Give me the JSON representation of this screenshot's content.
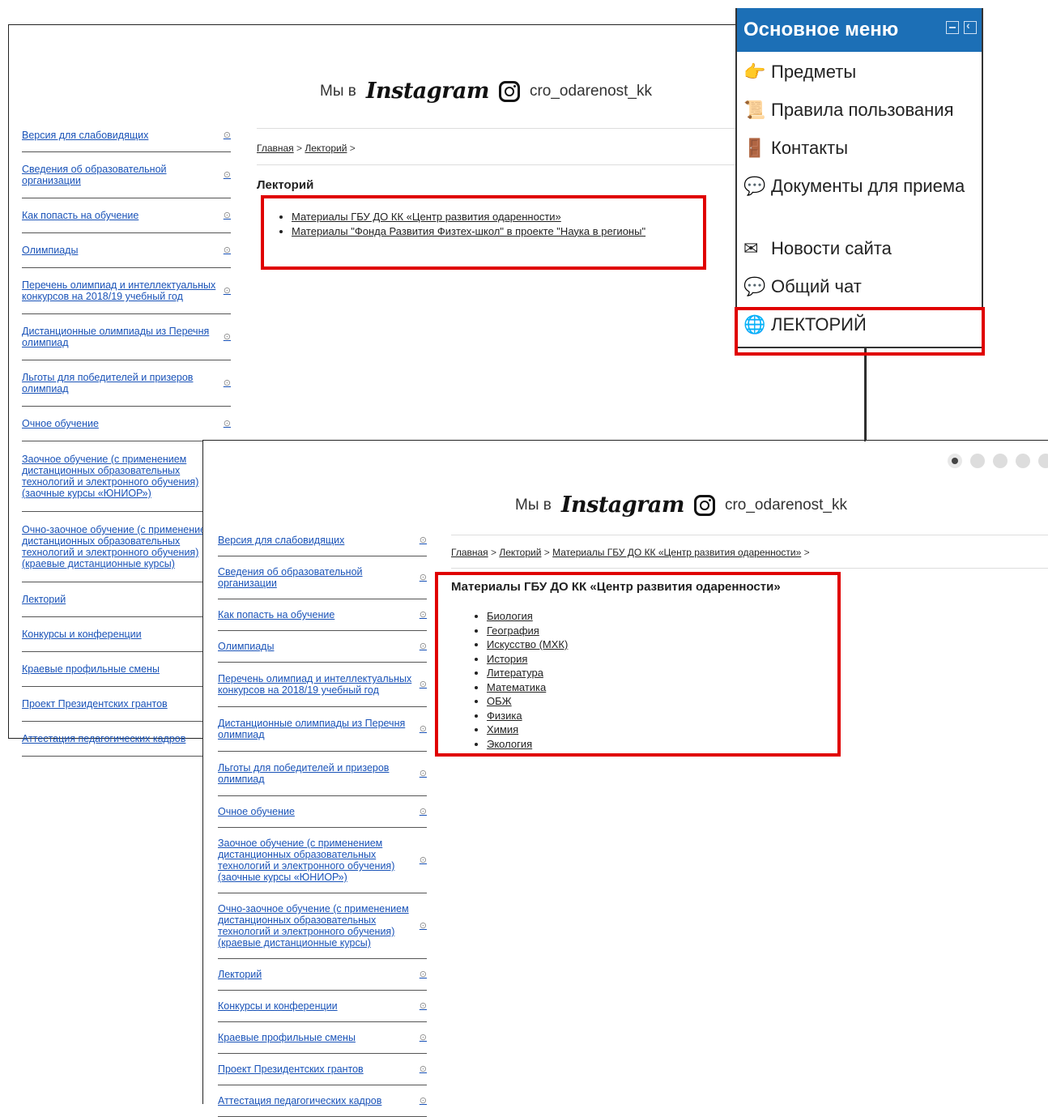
{
  "screen1": {
    "instagram": {
      "prefix": "Мы в",
      "logo_text": "Instagram",
      "handle": "cro_odarenost_kk"
    },
    "breadcrumb": {
      "home": "Главная",
      "sep1": " > ",
      "section": "Лекторий",
      "tail": " >"
    },
    "page_title": "Лекторий",
    "materials": [
      "Материалы ГБУ ДО КК «Центр развития одаренности»",
      "Материалы \"Фонда Развития Физтех-школ\" в проекте \"Наука в регионы\""
    ],
    "sidebar": [
      "Версия для слабовидящих",
      "Сведения об образовательной организации",
      "Как попасть на обучение",
      "Олимпиады",
      "Перечень олимпиад и интеллектуальных конкурсов на 2018/19 учебный год",
      "Дистанционные олимпиады из Перечня олимпиад",
      "Льготы для победителей и призеров олимпиад",
      "Очное обучение",
      "Заочное обучение (с применением дистанционных образовательных технологий и электронного обучения) (заочные курсы «ЮНИОР»)",
      "Очно-заочное обучение (с применением дистанционных образовательных технологий и электронного обучения) (краевые дистанционные курсы)",
      "Лекторий",
      "Конкурсы и конференции",
      "Краевые профильные смены",
      "Проект Президентских грантов",
      "Аттестация педагогических кадров"
    ]
  },
  "main_menu": {
    "title": "Основное меню",
    "items": [
      {
        "label": "Предметы",
        "icon": "hand-pointing-icon"
      },
      {
        "label": "Правила пользования",
        "icon": "scroll-icon"
      },
      {
        "label": "Контакты",
        "icon": "door-icon"
      },
      {
        "label": "Документы для приема",
        "icon": "chat-bubbles-icon"
      },
      {
        "label": "Новости сайта",
        "icon": "envelope-icon"
      },
      {
        "label": "Общий чат",
        "icon": "chat-bubbles-icon"
      },
      {
        "label": "ЛЕКТОРИЙ",
        "icon": "globe-document-icon"
      }
    ],
    "highlight_color": "#e00000",
    "header_color": "#1c6fb6"
  },
  "screen2": {
    "instagram": {
      "prefix": "Мы в",
      "logo_text": "Instagram",
      "handle": "cro_odarenost_kk"
    },
    "breadcrumb": {
      "home": "Главная",
      "sep1": " > ",
      "section": "Лекторий",
      "sep2": " > ",
      "page": "Материалы ГБУ ДО КК «Центр развития одаренности»",
      "tail": " >"
    },
    "page_title": "Материалы ГБУ ДО КК «Центр развития одаренности»",
    "subjects": [
      "Биология",
      "География",
      "Искусство (МХК)",
      "История",
      "Литература",
      "Математика",
      "ОБЖ",
      "Физика",
      "Химия",
      "Экология"
    ]
  },
  "carousel": {
    "count": 5,
    "active": 1
  }
}
